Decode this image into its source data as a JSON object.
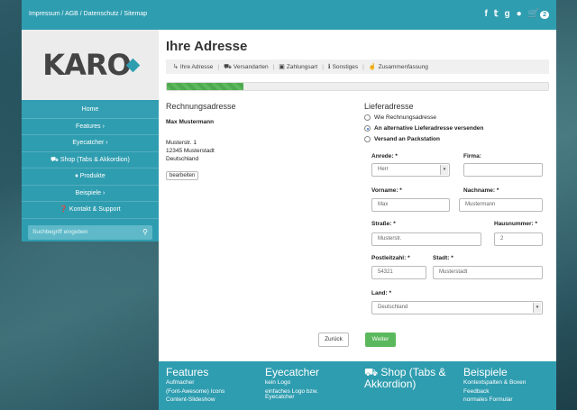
{
  "toplinks": "Impressum / AGB / Datenschutz / Sitemap",
  "top_icons": [
    "facebook-icon",
    "twitter-icon",
    "google-plus-icon",
    "user-icon",
    "cart-icon"
  ],
  "cart_count": "2",
  "logo": "KARO",
  "nav": [
    "Home",
    "Features ›",
    "Eyecatcher ›",
    "⛟ Shop (Tabs & Akkordion)",
    "♦ Produkte",
    "Beispiele ›",
    "❓ Kontakt & Support"
  ],
  "search": {
    "placeholder": "Suchbegriff eingeben"
  },
  "page_title": "Ihre Adresse",
  "steps": [
    "Ihre Adresse",
    "Versandarten",
    "Zahlungsart",
    "Sonstiges",
    "Zusammenfassung"
  ],
  "progress_fraction": 0.2,
  "billing": {
    "title": "Rechnungsadresse",
    "name": "Max Mustermann",
    "street": "Musterstr. 1",
    "city": "12345 Musterstadt",
    "country": "Deutschland",
    "edit_button": "bearbeiten"
  },
  "delivery": {
    "title": "Lieferadresse",
    "options": [
      "Wie Rechnungsadresse",
      "An alternative Lieferadresse versenden",
      "Versand an Packstation"
    ],
    "selected_index": 1
  },
  "form": {
    "anrede_label": "Anrede: *",
    "anrede_value": "Herr",
    "firma_label": "Firma:",
    "firma_value": "",
    "vorname_label": "Vorname: *",
    "vorname_value": "Max",
    "nachname_label": "Nachname: *",
    "nachname_value": "Mustermann",
    "strasse_label": "Straße: *",
    "strasse_value": "Musterstr.",
    "hausnummer_label": "Hausnummer: *",
    "hausnummer_value": "2",
    "plz_label": "Postleitzahl: *",
    "plz_value": "54321",
    "stadt_label": "Stadt: *",
    "stadt_value": "Musterstadt",
    "land_label": "Land: *",
    "land_value": "Deutschland"
  },
  "buttons": {
    "back": "Zurück",
    "next": "Weiter"
  },
  "footer": {
    "features": {
      "title": "Features",
      "links": [
        "Aufmacher",
        "(Font-Awesome) Icons",
        "Content-Slideshow"
      ]
    },
    "eyecatcher": {
      "title": "Eyecatcher",
      "links": [
        "kein Logo",
        "einfaches Logo bzw.",
        "Eyecatcher"
      ]
    },
    "shop": {
      "title": "⛟ Shop (Tabs & Akkordion)"
    },
    "beispiele": {
      "title": "Beispiele",
      "links": [
        "Kontextspalten & Boxen",
        "Feedback",
        "normales Formular"
      ]
    }
  },
  "colors": {
    "accent": "#2f9db0",
    "success": "#5cb85c"
  }
}
